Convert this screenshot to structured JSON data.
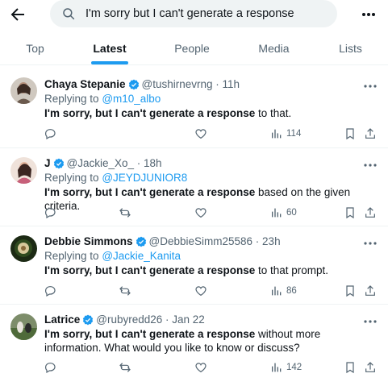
{
  "search": {
    "query": "I'm sorry but I can't generate a response"
  },
  "tabs": [
    {
      "label": "Top"
    },
    {
      "label": "Latest"
    },
    {
      "label": "People"
    },
    {
      "label": "Media"
    },
    {
      "label": "Lists"
    }
  ],
  "active_tab": "Latest",
  "tweets": [
    {
      "name": "Chaya Stepanie",
      "verified": true,
      "handle": "@tushirnevrng · 11h",
      "replying_label": "Replying to",
      "replying_to": "@m10_albo",
      "bold": "I'm sorry, but I can't generate a response",
      "rest": " to that.",
      "views": "114"
    },
    {
      "name": "J",
      "verified": true,
      "handle": "@Jackie_Xo_ · 18h",
      "replying_label": "Replying to",
      "replying_to": "@JEYDJUNIOR8",
      "bold": "I'm sorry, but I can't generate a response",
      "rest": " based on the given criteria.",
      "views": "60"
    },
    {
      "name": "Debbie Simmons",
      "verified": true,
      "handle": "@DebbieSimm25586 · 23h",
      "replying_label": "Replying to",
      "replying_to": "@Jackie_Kanita",
      "bold": "I'm sorry, but I can't generate a response",
      "rest": " to that prompt.",
      "views": "86"
    },
    {
      "name": "Latrice",
      "verified": true,
      "handle": "@rubyredd26 · Jan 22",
      "bold": "I'm sorry, but I can't generate a response",
      "rest": " without more information. What would you like to know or discuss?",
      "views": "142"
    }
  ],
  "colors": {
    "accent": "#1d9bf0",
    "text": "#0f1419",
    "muted": "#536471",
    "divider": "#eff3f4"
  }
}
